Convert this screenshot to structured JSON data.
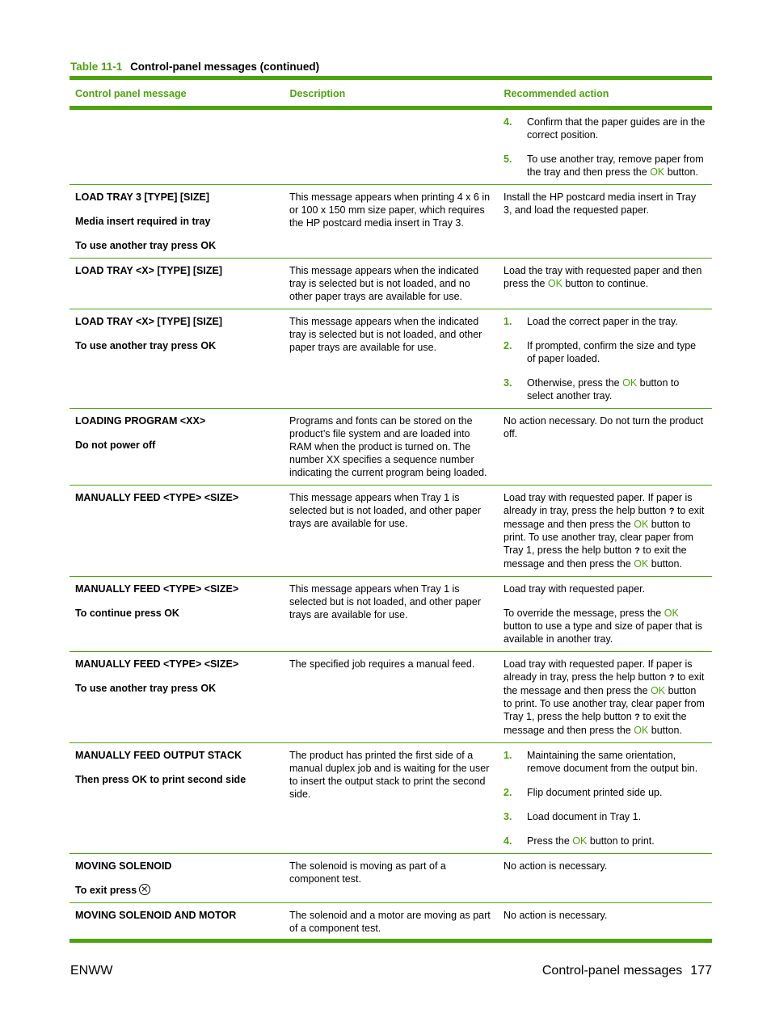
{
  "caption": {
    "number": "Table 11-1",
    "title": "Control-panel messages (continued)"
  },
  "columns": [
    "Control panel message",
    "Description",
    "Recommended action"
  ],
  "ok_label": "OK",
  "help_glyph": "?",
  "rows": [
    {
      "message": [],
      "description": [],
      "action_steps": [
        {
          "n": "4.",
          "parts": [
            "Confirm that the paper guides are in the correct position."
          ]
        },
        {
          "n": "5.",
          "parts": [
            "To use another tray, remove paper from the tray and then press the ",
            "OK",
            " button."
          ]
        }
      ]
    },
    {
      "message": [
        "LOAD TRAY 3 [TYPE] [SIZE]",
        "Media insert required in tray",
        "To use another tray press OK"
      ],
      "description": [
        "This message appears when printing 4 x 6 in or 100 x 150 mm size paper, which requires the HP postcard media insert in Tray 3."
      ],
      "action": "Install the HP postcard media insert in Tray 3, and load the requested paper."
    },
    {
      "message": [
        "LOAD TRAY <X> [TYPE] [SIZE]"
      ],
      "description": [
        "This message appears when the indicated tray is selected but is not loaded, and no other paper trays are available for use."
      ],
      "action_parts": [
        "Load the tray with requested paper and then press the ",
        "OK",
        " button to continue."
      ]
    },
    {
      "message": [
        "LOAD TRAY <X> [TYPE] [SIZE]",
        "To use another tray press OK"
      ],
      "description": [
        "This message appears when the indicated tray is selected but is not loaded, and other paper trays are available for use."
      ],
      "action_steps": [
        {
          "n": "1.",
          "parts": [
            "Load the correct paper in the tray."
          ]
        },
        {
          "n": "2.",
          "parts": [
            "If prompted, confirm the size and type of paper loaded."
          ]
        },
        {
          "n": "3.",
          "parts": [
            "Otherwise, press the ",
            "OK",
            " button to select another tray."
          ]
        }
      ]
    },
    {
      "message": [
        "LOADING PROGRAM <XX>",
        "Do not power off"
      ],
      "description": [
        "Programs and fonts can be stored on the product’s file system and are loaded into RAM when the product is turned on. The number XX specifies a sequence number indicating the current program being loaded."
      ],
      "action": "No action necessary. Do not turn the product off."
    },
    {
      "message": [
        "MANUALLY FEED <TYPE> <SIZE>"
      ],
      "description": [
        "This message appears when Tray 1 is selected but is not loaded, and other paper trays are available for use."
      ],
      "action_parts": [
        "Load tray with requested paper. If paper is already in tray, press the help button ",
        "?",
        " to exit message and then press the ",
        "OK",
        " button to print. To use another tray, clear paper from Tray 1, press the help button ",
        "?",
        " to exit the message and then press the ",
        "OK",
        " button."
      ]
    },
    {
      "message": [
        "MANUALLY FEED <TYPE> <SIZE>",
        "To continue press OK"
      ],
      "description": [
        "This message appears when Tray 1 is selected but is not loaded, and other paper trays are available for use."
      ],
      "action": "Load tray with requested paper.",
      "action2_parts": [
        "To override the message, press the ",
        "OK",
        " button to use a type and size of paper that is available in another tray."
      ]
    },
    {
      "message": [
        "MANUALLY FEED <TYPE> <SIZE>",
        "To use another tray press OK"
      ],
      "description": [
        "The specified job requires a manual feed."
      ],
      "action_parts": [
        "Load tray with requested paper. If paper is already in tray, press the help button ",
        "?",
        " to exit the message and then press the ",
        "OK",
        " button to print. To use another tray, clear paper from Tray 1, press the help button ",
        "?",
        " to exit the message and then press the ",
        "OK",
        " button."
      ]
    },
    {
      "message": [
        "MANUALLY FEED OUTPUT STACK",
        "Then press OK to print second side"
      ],
      "description": [
        "The product has printed the first side of a manual duplex job and is waiting for the user to insert the output stack to print the second side."
      ],
      "action_steps": [
        {
          "n": "1.",
          "parts": [
            "Maintaining the same orientation, remove document from the output bin."
          ]
        },
        {
          "n": "2.",
          "parts": [
            "Flip document printed side up."
          ]
        },
        {
          "n": "3.",
          "parts": [
            "Load document in Tray 1."
          ]
        },
        {
          "n": "4.",
          "parts": [
            "Press the ",
            "OK",
            " button to print."
          ]
        }
      ]
    },
    {
      "message": [
        "MOVING SOLENOID",
        "To exit press"
      ],
      "message_icon": "cancel-x-circle-icon",
      "description": [
        "The solenoid is moving as part of a component test."
      ],
      "action": "No action is necessary."
    },
    {
      "message": [
        "MOVING SOLENOID AND MOTOR"
      ],
      "description": [
        "The solenoid and a motor are moving as part of a component test."
      ],
      "action": "No action is necessary."
    }
  ],
  "footer": {
    "left": "ENWW",
    "section": "Control-panel messages",
    "page": "177"
  },
  "colors": {
    "accent": "#4ca30d"
  }
}
